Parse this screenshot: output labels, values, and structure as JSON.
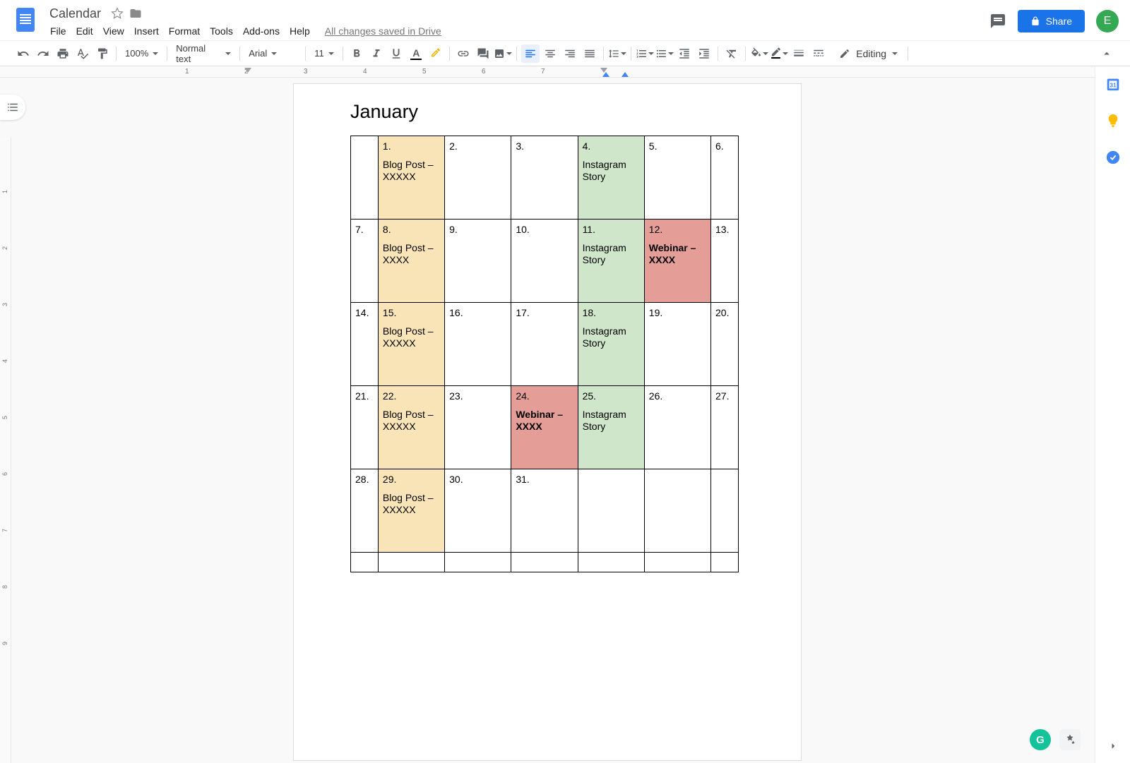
{
  "header": {
    "doc_title": "Calendar",
    "menus": [
      "File",
      "Edit",
      "View",
      "Insert",
      "Format",
      "Tools",
      "Add-ons",
      "Help"
    ],
    "save_status": "All changes saved in Drive",
    "share_label": "Share",
    "avatar_letter": "E"
  },
  "toolbar": {
    "zoom": "100%",
    "style": "Normal text",
    "font": "Arial",
    "font_size": "11",
    "mode": "Editing"
  },
  "ruler": {
    "h_marks": [
      "1",
      "2",
      "3",
      "4",
      "5",
      "6",
      "7"
    ],
    "v_marks": [
      "1",
      "2",
      "3",
      "4",
      "5",
      "6",
      "7",
      "8",
      "9"
    ]
  },
  "document": {
    "title": "January",
    "rows": [
      [
        {
          "num": "",
          "event": "",
          "color": ""
        },
        {
          "num": "1.",
          "event": "Blog Post  – XXXXX",
          "color": "yellow"
        },
        {
          "num": "2.",
          "event": "",
          "color": ""
        },
        {
          "num": "3.",
          "event": "",
          "color": ""
        },
        {
          "num": "4.",
          "event": "Instagram Story",
          "color": "green"
        },
        {
          "num": "5.",
          "event": "",
          "color": ""
        },
        {
          "num": "6.",
          "event": "",
          "color": ""
        }
      ],
      [
        {
          "num": "7.",
          "event": "",
          "color": ""
        },
        {
          "num": "8.",
          "event": "Blog Post – XXXX",
          "color": "yellow"
        },
        {
          "num": "9.",
          "event": "",
          "color": ""
        },
        {
          "num": "10.",
          "event": "",
          "color": ""
        },
        {
          "num": "11.",
          "event": "Instagram Story",
          "color": "green"
        },
        {
          "num": "12.",
          "event": "Webinar – XXXX",
          "color": "red",
          "bold": true
        },
        {
          "num": "13.",
          "event": "",
          "color": ""
        }
      ],
      [
        {
          "num": "14.",
          "event": "",
          "color": ""
        },
        {
          "num": "15.",
          "event": "Blog Post  – XXXXX",
          "color": "yellow"
        },
        {
          "num": "16.",
          "event": "",
          "color": ""
        },
        {
          "num": "17.",
          "event": "",
          "color": ""
        },
        {
          "num": "18.",
          "event": "Instagram Story",
          "color": "green"
        },
        {
          "num": "19.",
          "event": "",
          "color": ""
        },
        {
          "num": "20.",
          "event": "",
          "color": ""
        }
      ],
      [
        {
          "num": "21.",
          "event": "",
          "color": ""
        },
        {
          "num": "22.",
          "event": "Blog Post  – XXXXX",
          "color": "yellow"
        },
        {
          "num": "23.",
          "event": "",
          "color": ""
        },
        {
          "num": "24.",
          "event": "Webinar – XXXX",
          "color": "red",
          "bold": true
        },
        {
          "num": "25.",
          "event": "Instagram Story",
          "color": "green"
        },
        {
          "num": "26.",
          "event": "",
          "color": ""
        },
        {
          "num": "27.",
          "event": "",
          "color": ""
        }
      ],
      [
        {
          "num": "28.",
          "event": "",
          "color": ""
        },
        {
          "num": "29.",
          "event": "Blog Post  – XXXXX",
          "color": "yellow"
        },
        {
          "num": "30.",
          "event": "",
          "color": ""
        },
        {
          "num": "31.",
          "event": "",
          "color": ""
        },
        {
          "num": "",
          "event": "",
          "color": ""
        },
        {
          "num": "",
          "event": "",
          "color": ""
        },
        {
          "num": "",
          "event": "",
          "color": ""
        }
      ]
    ]
  }
}
